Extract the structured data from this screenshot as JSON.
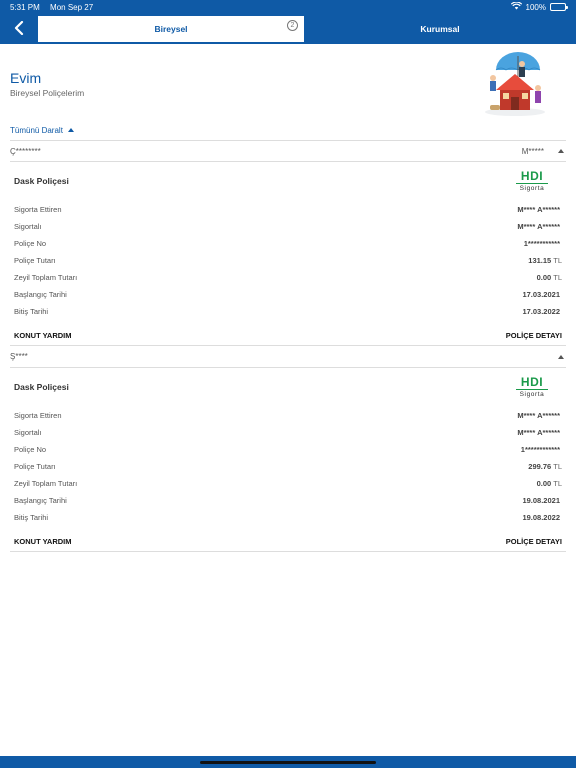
{
  "status_bar": {
    "time": "5:31 PM",
    "date": "Mon Sep 27",
    "battery": "100%"
  },
  "nav": {
    "tabs": [
      {
        "label": "Bireysel",
        "badge": "2"
      },
      {
        "label": "Kurumsal"
      }
    ]
  },
  "header": {
    "title": "Evim",
    "subtitle": "Bireysel Poliçelerim"
  },
  "collapse_label": "Tümünü Daralt",
  "sections": [
    {
      "owner": "Ç********",
      "right_text": "M*****",
      "policy_type": "Dask Poliçesi",
      "logo_text": "HDI",
      "logo_sub": "Sigorta",
      "rows": [
        {
          "label": "Sigorta Ettiren",
          "value": "M**** A******",
          "unit": ""
        },
        {
          "label": "Sigortalı",
          "value": "M**** A******",
          "unit": ""
        },
        {
          "label": "Poliçe No",
          "value": "1***********",
          "unit": ""
        },
        {
          "label": "Poliçe Tutarı",
          "value": "131.15",
          "unit": "TL"
        },
        {
          "label": "Zeyil Toplam Tutarı",
          "value": "0.00",
          "unit": "TL"
        },
        {
          "label": "Başlangıç Tarihi",
          "value": "17.03.2021",
          "unit": ""
        },
        {
          "label": "Bitiş Tarihi",
          "value": "17.03.2022",
          "unit": ""
        }
      ],
      "footer_left": "KONUT YARDIM",
      "footer_right": "POLİÇE DETAYI"
    },
    {
      "owner": "Ş****",
      "right_text": "",
      "policy_type": "Dask Poliçesi",
      "logo_text": "HDI",
      "logo_sub": "Sigorta",
      "rows": [
        {
          "label": "Sigorta Ettiren",
          "value": "M**** A******",
          "unit": ""
        },
        {
          "label": "Sigortalı",
          "value": "M**** A******",
          "unit": ""
        },
        {
          "label": "Poliçe No",
          "value": "1************",
          "unit": ""
        },
        {
          "label": "Poliçe Tutarı",
          "value": "299.76",
          "unit": "TL"
        },
        {
          "label": "Zeyil Toplam Tutarı",
          "value": "0.00",
          "unit": "TL"
        },
        {
          "label": "Başlangıç Tarihi",
          "value": "19.08.2021",
          "unit": ""
        },
        {
          "label": "Bitiş Tarihi",
          "value": "19.08.2022",
          "unit": ""
        }
      ],
      "footer_left": "KONUT YARDIM",
      "footer_right": "POLİÇE DETAYI"
    }
  ]
}
